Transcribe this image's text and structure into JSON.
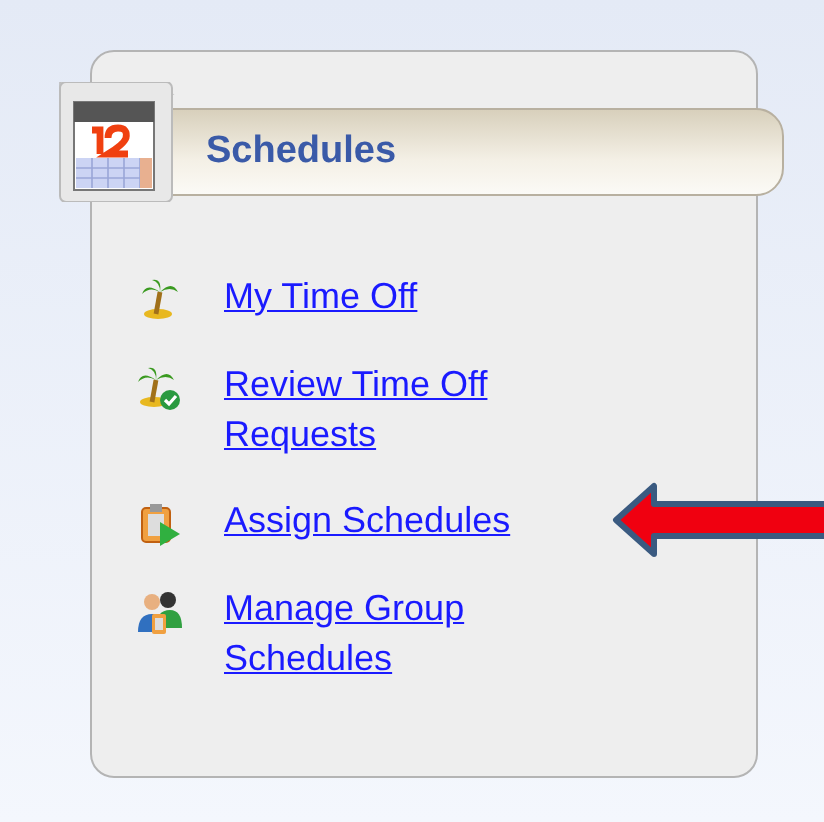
{
  "panel": {
    "title": "Schedules",
    "items": [
      {
        "kind": "palm",
        "label": "My Time Off",
        "highlighted": false
      },
      {
        "kind": "palm-check",
        "label": "Review Time Off Requests",
        "highlighted": false
      },
      {
        "kind": "clipboard-play",
        "label": "Assign Schedules",
        "highlighted": true
      },
      {
        "kind": "people",
        "label": "Manage Group Schedules",
        "highlighted": false
      }
    ]
  }
}
